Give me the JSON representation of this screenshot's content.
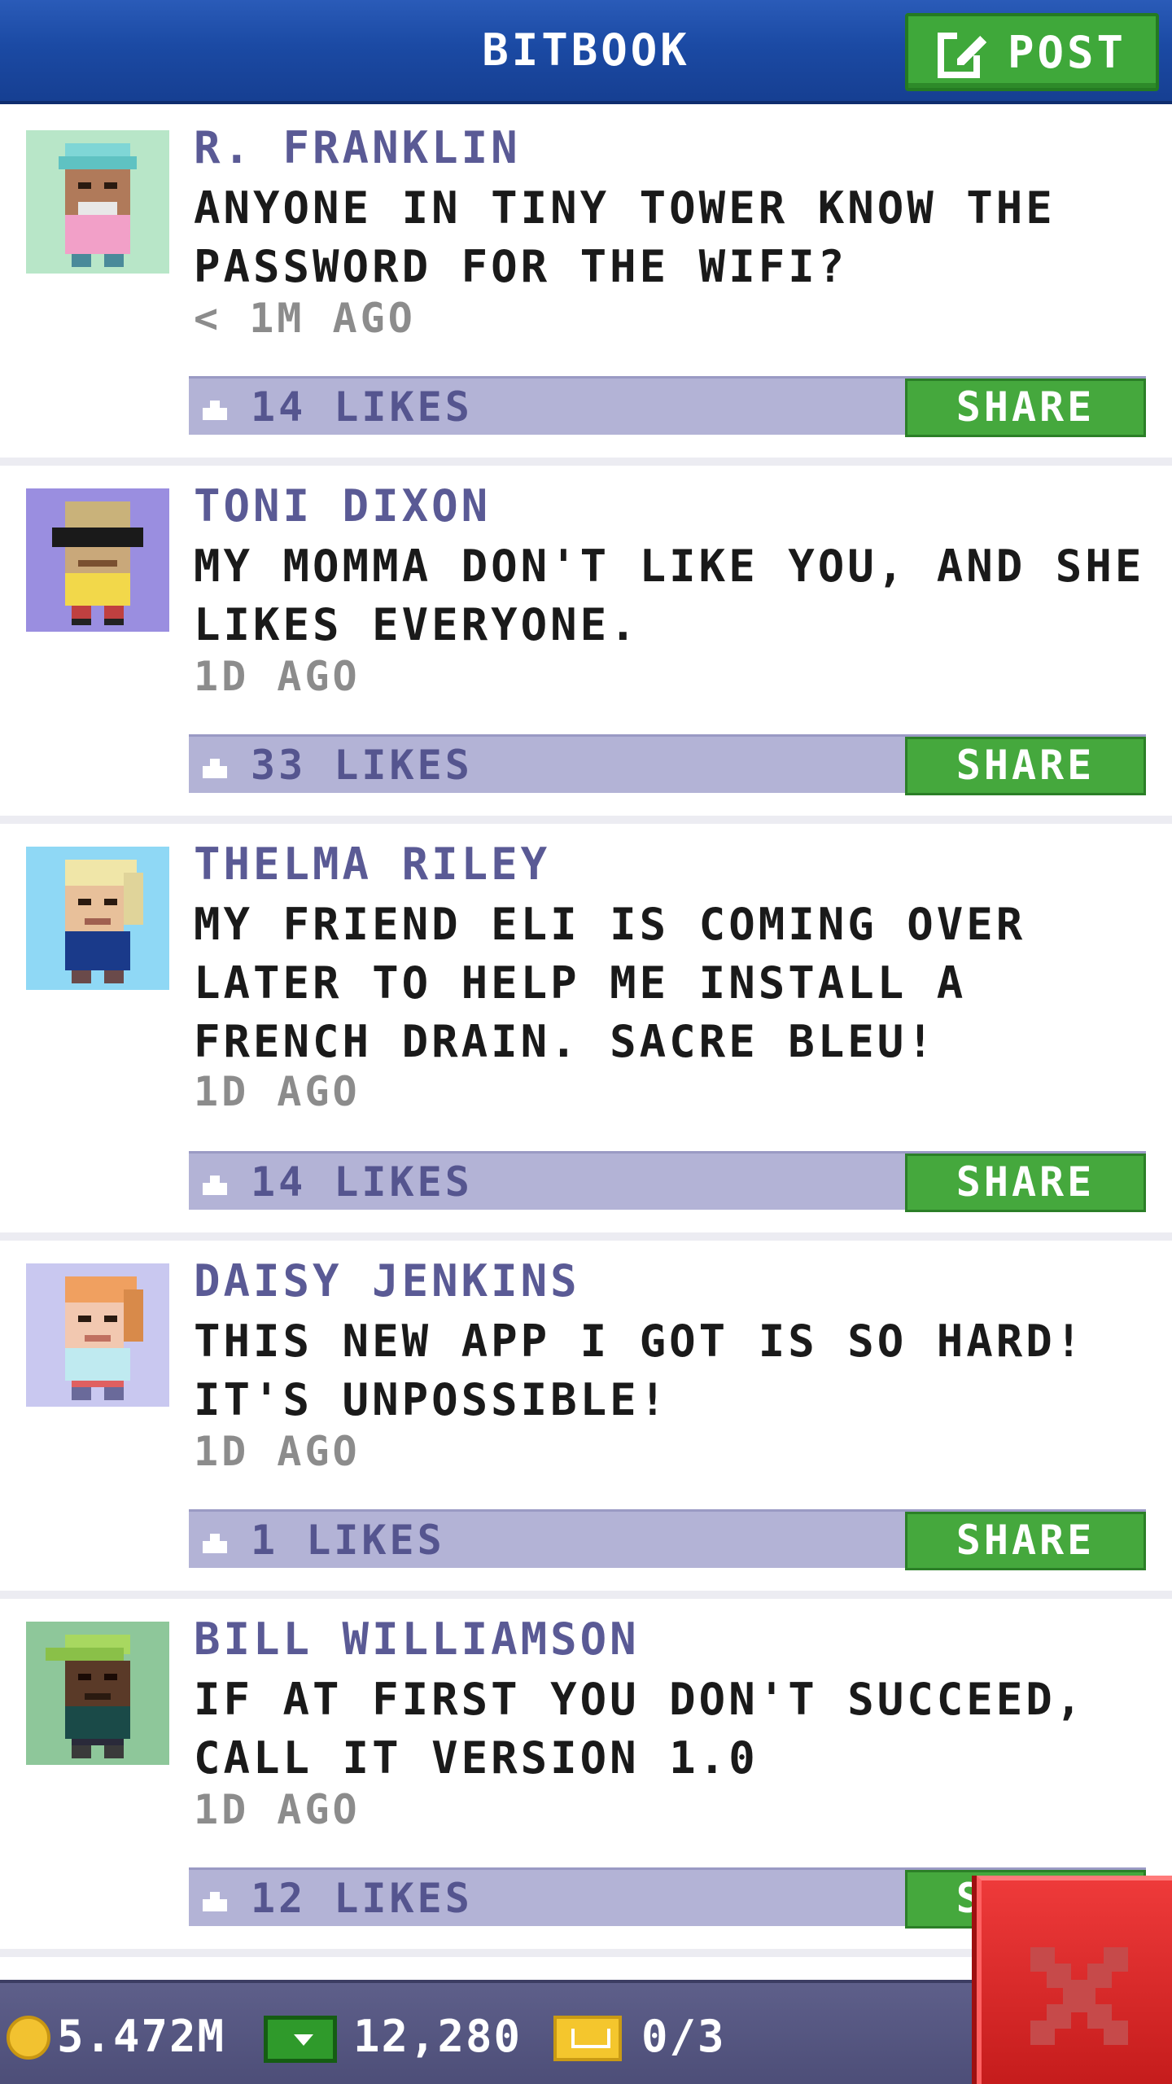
{
  "header": {
    "title": "BITBOOK",
    "post_label": "POST"
  },
  "posts": [
    {
      "author": "R. FRANKLIN",
      "message": "ANYONE IN TINY TOWER KNOW THE PASSWORD FOR THE WIFI?",
      "time": "< 1M AGO",
      "likes": "14 LIKES",
      "share_label": "SHARE",
      "avatar_bg": "#b8e6c8"
    },
    {
      "author": "TONI DIXON",
      "message": "MY MOMMA DON'T LIKE YOU, AND SHE LIKES EVERYONE.",
      "time": "1D AGO",
      "likes": "33 LIKES",
      "share_label": "SHARE",
      "avatar_bg": "#9a8ee0"
    },
    {
      "author": "THELMA RILEY",
      "message": "MY FRIEND ELI IS COMING OVER LATER TO HELP ME INSTALL A FRENCH DRAIN. SACRE BLEU!",
      "time": "1D AGO",
      "likes": "14 LIKES",
      "share_label": "SHARE",
      "avatar_bg": "#8fd8f5"
    },
    {
      "author": "DAISY JENKINS",
      "message": "THIS NEW APP I GOT IS SO HARD! IT'S UNPOSSIBLE!",
      "time": "1D AGO",
      "likes": "1 LIKES",
      "share_label": "SHARE",
      "avatar_bg": "#c9c8f0"
    },
    {
      "author": "BILL WILLIAMSON",
      "message": "IF AT FIRST YOU DON'T SUCCEED, CALL IT VERSION 1.0",
      "time": "1D AGO",
      "likes": "12 LIKES",
      "share_label": "SHARE",
      "avatar_bg": "#8ec79a"
    }
  ],
  "footer": {
    "coins": "5.472M",
    "bux": "12,280",
    "tickets": "0/3"
  },
  "colors": {
    "header_blue": "#1b4aa4",
    "share_green": "#45a83d",
    "likes_bar": "#b3b3d6",
    "close_red": "#e02a2a"
  }
}
